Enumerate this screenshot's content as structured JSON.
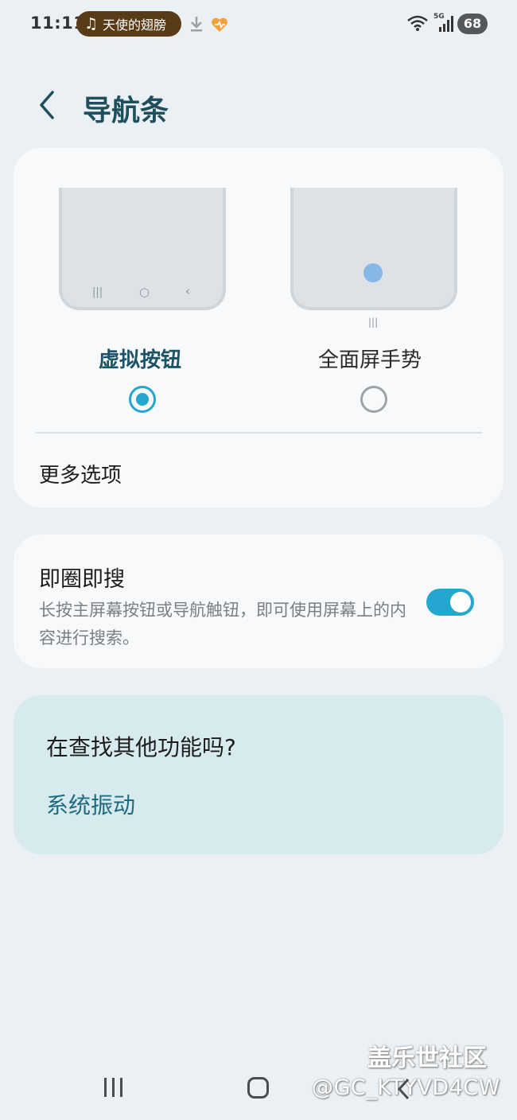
{
  "status_bar": {
    "time": "11:11",
    "music_title": "天使的翅膀",
    "network_type": "5G",
    "battery": "68",
    "icons": [
      "music-note-icon",
      "download-icon",
      "heart-icon",
      "wifi-icon",
      "signal-icon"
    ]
  },
  "header": {
    "title": "导航条"
  },
  "navigation_type": {
    "options": [
      {
        "label": "虚拟按钮",
        "selected": true
      },
      {
        "label": "全面屏手势",
        "selected": false
      }
    ],
    "more_options": "更多选项"
  },
  "circle_to_search": {
    "title": "即圈即搜",
    "description": "长按主屏幕按钮或导航触钮，即可使用屏幕上的内容进行搜索。",
    "enabled": true
  },
  "help_card": {
    "title": "在查找其他功能吗?",
    "link": "系统振动"
  },
  "watermark": {
    "line1": "盖乐世社区",
    "line2": "@GC_KTYVD4CW"
  },
  "colors": {
    "accent": "#23a7cf",
    "title": "#1f4f5c",
    "background": "#eaf0f3"
  }
}
